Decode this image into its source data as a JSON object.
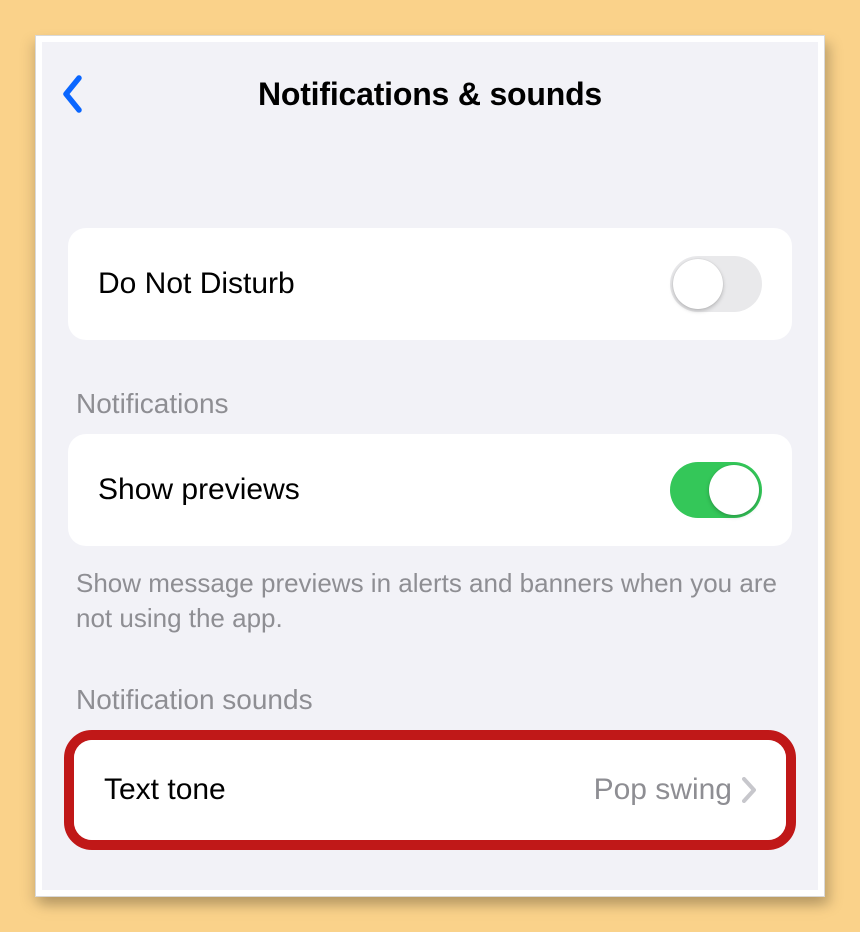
{
  "page_title": "Notifications & sounds",
  "rows": {
    "dnd": {
      "label": "Do Not Disturb",
      "on": false
    },
    "previews": {
      "label": "Show previews",
      "on": true
    },
    "text_tone": {
      "label": "Text tone",
      "value": "Pop swing"
    }
  },
  "sections": {
    "notifications_header": "Notifications",
    "previews_footer": "Show message previews in alerts and banners when you are not using the app.",
    "sounds_header": "Notification sounds"
  },
  "colors": {
    "accent_back": "#0a66ff",
    "toggle_on": "#34c759",
    "highlight": "#c01818"
  }
}
